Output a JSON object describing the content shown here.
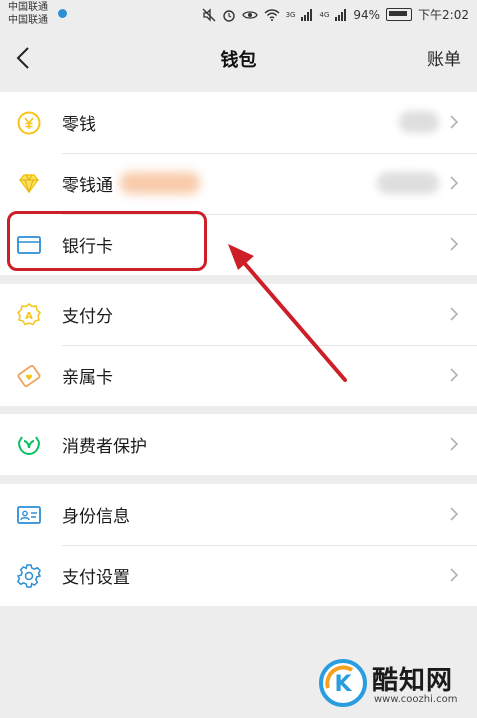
{
  "status_bar": {
    "carrier_1": "中国联通",
    "carrier_2": "中国联通",
    "net_3g": "3G",
    "net_4g": "4G",
    "battery": "94%",
    "time": "下午2:02"
  },
  "nav": {
    "title": "钱包",
    "bill_label": "账单"
  },
  "groups": [
    {
      "items": [
        {
          "label": "零钱",
          "icon": "yuan-coin-icon"
        },
        {
          "label": "零钱通",
          "icon": "diamond-icon"
        },
        {
          "label": "银行卡",
          "icon": "bank-card-icon"
        }
      ]
    },
    {
      "items": [
        {
          "label": "支付分",
          "icon": "payment-score-icon"
        },
        {
          "label": "亲属卡",
          "icon": "family-card-icon"
        }
      ]
    },
    {
      "items": [
        {
          "label": "消费者保护",
          "icon": "consumer-protection-icon"
        }
      ]
    },
    {
      "items": [
        {
          "label": "身份信息",
          "icon": "id-card-icon"
        },
        {
          "label": "支付设置",
          "icon": "settings-gear-icon"
        }
      ]
    }
  ],
  "colors": {
    "background": "#ededed",
    "accent_green": "#07c160",
    "icon_yellow": "#f5c518",
    "icon_blue": "#2c8fd6",
    "annotation_red": "#cc1f27"
  },
  "watermark": {
    "name": "酷知网",
    "url": "www.coozhi.com"
  }
}
